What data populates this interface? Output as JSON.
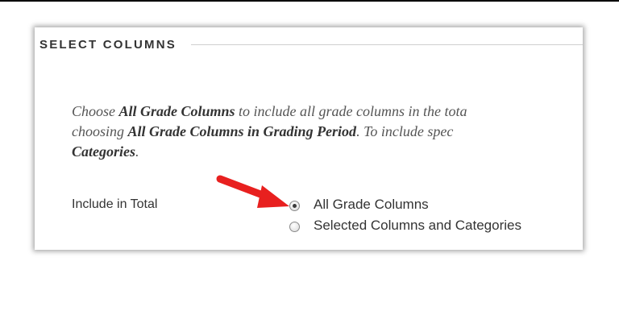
{
  "section": {
    "title": "SELECT COLUMNS"
  },
  "instructions": {
    "line1": [
      {
        "text": "Choose ",
        "bold": false
      },
      {
        "text": "All Grade Columns",
        "bold": true
      },
      {
        "text": " to include all grade columns in the tota",
        "bold": false
      }
    ],
    "line2": [
      {
        "text": "choosing ",
        "bold": false
      },
      {
        "text": "All Grade Columns in Grading Period",
        "bold": true
      },
      {
        "text": ". To include spec",
        "bold": false
      }
    ],
    "line3": [
      {
        "text": "Categories",
        "bold": true
      },
      {
        "text": ".",
        "bold": false
      }
    ]
  },
  "include_in_total": {
    "label": "Include in Total",
    "options": [
      {
        "label": "All Grade Columns",
        "selected": true
      },
      {
        "label": "Selected Columns and Categories",
        "selected": false
      }
    ]
  },
  "annotation": {
    "arrow_color": "#e8201f"
  }
}
